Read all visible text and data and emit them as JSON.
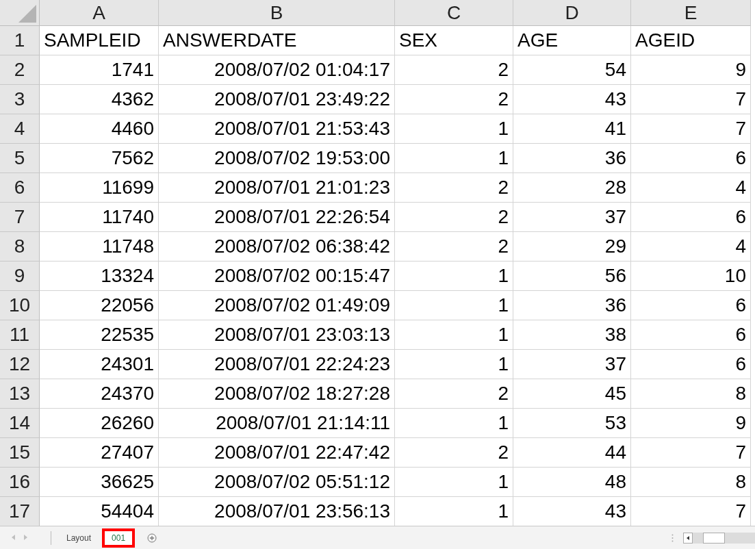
{
  "columns": [
    "A",
    "B",
    "C",
    "D",
    "E"
  ],
  "rows": [
    {
      "number": "1",
      "kind": "text",
      "cells": [
        "SAMPLEID",
        "ANSWERDATE",
        "SEX",
        "AGE",
        "AGEID"
      ]
    },
    {
      "number": "2",
      "kind": "number",
      "cells": [
        "1741",
        "2008/07/02 01:04:17",
        "2",
        "54",
        "9"
      ]
    },
    {
      "number": "3",
      "kind": "number",
      "cells": [
        "4362",
        "2008/07/01 23:49:22",
        "2",
        "43",
        "7"
      ]
    },
    {
      "number": "4",
      "kind": "number",
      "cells": [
        "4460",
        "2008/07/01 21:53:43",
        "1",
        "41",
        "7"
      ]
    },
    {
      "number": "5",
      "kind": "number",
      "cells": [
        "7562",
        "2008/07/02 19:53:00",
        "1",
        "36",
        "6"
      ]
    },
    {
      "number": "6",
      "kind": "number",
      "cells": [
        "11699",
        "2008/07/01 21:01:23",
        "2",
        "28",
        "4"
      ]
    },
    {
      "number": "7",
      "kind": "number",
      "cells": [
        "11740",
        "2008/07/01 22:26:54",
        "2",
        "37",
        "6"
      ]
    },
    {
      "number": "8",
      "kind": "number",
      "cells": [
        "11748",
        "2008/07/02 06:38:42",
        "2",
        "29",
        "4"
      ]
    },
    {
      "number": "9",
      "kind": "number",
      "cells": [
        "13324",
        "2008/07/02 00:15:47",
        "1",
        "56",
        "10"
      ]
    },
    {
      "number": "10",
      "kind": "number",
      "cells": [
        "22056",
        "2008/07/02 01:49:09",
        "1",
        "36",
        "6"
      ]
    },
    {
      "number": "11",
      "kind": "number",
      "cells": [
        "22535",
        "2008/07/01 23:03:13",
        "1",
        "38",
        "6"
      ]
    },
    {
      "number": "12",
      "kind": "number",
      "cells": [
        "24301",
        "2008/07/01 22:24:23",
        "1",
        "37",
        "6"
      ]
    },
    {
      "number": "13",
      "kind": "number",
      "cells": [
        "24370",
        "2008/07/02 18:27:28",
        "2",
        "45",
        "8"
      ]
    },
    {
      "number": "14",
      "kind": "number",
      "cells": [
        "26260",
        "2008/07/01 21:14:11",
        "1",
        "53",
        "9"
      ]
    },
    {
      "number": "15",
      "kind": "number",
      "cells": [
        "27407",
        "2008/07/01 22:47:42",
        "2",
        "44",
        "7"
      ]
    },
    {
      "number": "16",
      "kind": "number",
      "cells": [
        "36625",
        "2008/07/02 05:51:12",
        "1",
        "48",
        "8"
      ]
    },
    {
      "number": "17",
      "kind": "number",
      "cells": [
        "54404",
        "2008/07/01 23:56:13",
        "1",
        "43",
        "7"
      ]
    }
  ],
  "sheet_tabs": [
    {
      "label": "Layout",
      "selected": false,
      "annotated": false
    },
    {
      "label": "001",
      "selected": true,
      "annotated": true
    }
  ]
}
